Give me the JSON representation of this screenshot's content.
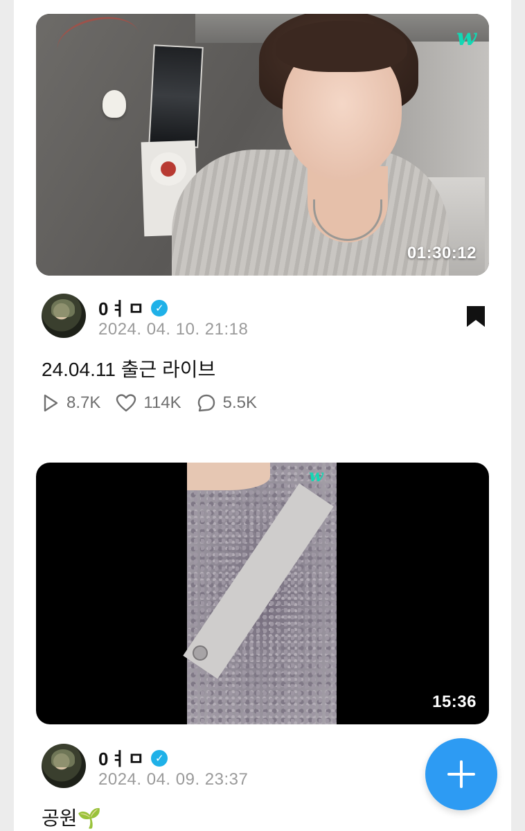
{
  "brand": {
    "logo_text": "w",
    "accent_color": "#12d8b4",
    "fab_color": "#2d9bf3",
    "verified_color": "#1fb1e8"
  },
  "posts": [
    {
      "duration": "01:30:12",
      "author": "0ㅕㅁ",
      "verified": true,
      "date": "2024. 04. 10. 21:18",
      "title": "24.04.11 출근 라이브",
      "stats": {
        "plays": "8.7K",
        "likes": "114K",
        "comments": "5.5K"
      },
      "bookmarked": true,
      "icons": [
        "play-icon",
        "heart-icon",
        "comment-icon",
        "bookmark-icon",
        "verified-badge-icon"
      ]
    },
    {
      "duration": "15:36",
      "author": "0ㅕㅁ",
      "verified": true,
      "date": "2024. 04. 09. 23:37",
      "title": "공원🌱"
    }
  ],
  "fab": {
    "icon": "plus-icon"
  }
}
